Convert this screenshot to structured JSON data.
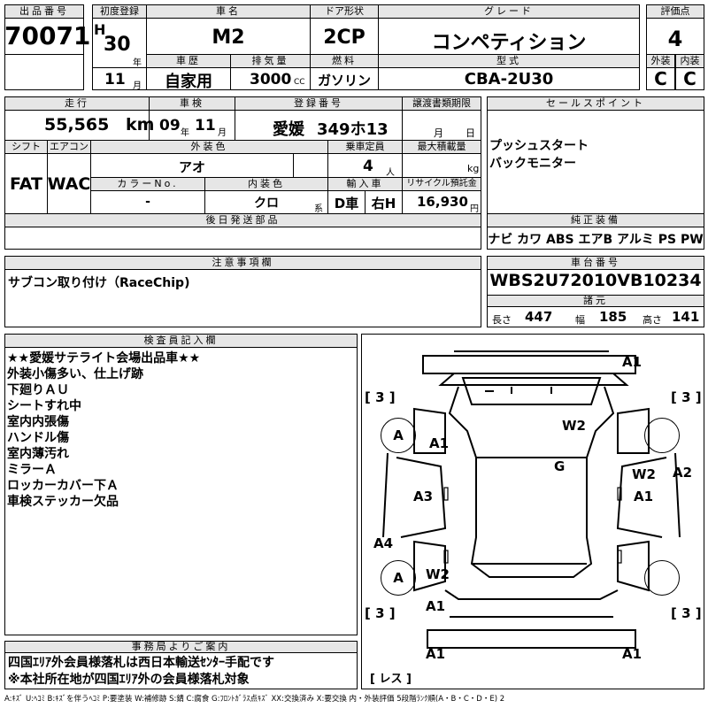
{
  "labels": {
    "lot_no": "出品番号",
    "first_reg": "初度登録",
    "car_name": "車名",
    "door": "ドア形状",
    "grade": "グレード",
    "score": "評価点",
    "history": "車歴",
    "displacement": "排気量",
    "fuel": "燃料",
    "model_code": "型式",
    "exterior": "外装",
    "interior": "内装",
    "mileage": "走行",
    "inspection": "車検",
    "reg_no": "登録番号",
    "transfer_docs": "譲渡書類期限",
    "sales_points": "セールスポイント",
    "shift": "シフト",
    "ac": "エアコン",
    "ext_color": "外装色",
    "capacity": "乗車定員",
    "max_load": "最大積載量",
    "color_no": "カラーNo.",
    "int_color": "内装色",
    "import": "輸入車",
    "recycle": "リサイクル預託金",
    "later_parts": "後日発送部品",
    "genuine_equip": "純正装備",
    "caution": "注意事項欄",
    "chassis_no": "車台番号",
    "specs": "諸元",
    "inspector": "検査員記入欄",
    "office": "事務局よりご案内",
    "year_unit": "年",
    "month_unit": "月",
    "month_unit2": "月",
    "day_unit": "日",
    "km_unit": "km",
    "cc_unit": "CC",
    "kg_unit": "kg",
    "person_unit": "人",
    "yen_unit": "円",
    "kei_unit": "系",
    "year_unit2": "年",
    "month_unit3": "月",
    "length": "長さ",
    "width": "幅",
    "height": "高さ"
  },
  "vehicle": {
    "lot_number": "70071",
    "era": "H",
    "year": "30",
    "month": "11",
    "name": "M2",
    "door": "2CP",
    "grade": "コンペティション",
    "score": "4",
    "history": "自家用",
    "displacement": "3000",
    "fuel": "ガソリン",
    "model_code": "CBA-2U30",
    "exterior_grade": "C",
    "interior_grade": "C",
    "mileage": "55,565",
    "inspection_year": "09",
    "inspection_month": "11",
    "reg_area": "愛媛",
    "reg_number": "349ホ13",
    "shift": "FAT",
    "ac": "WAC",
    "ext_color": "アオ",
    "capacity": "4",
    "color_no": "-",
    "int_color": "クロ",
    "import_type": "D車",
    "steering": "右H",
    "recycle_fee": "16,930",
    "chassis_no": "WBS2U72010VB10234",
    "length": "447",
    "width": "185",
    "height": "141"
  },
  "sales_points": [
    "プッシュスタート",
    "バックモニター"
  ],
  "equipment": "ナビ カワ ABS エアB アルミ PS PW",
  "caution_text": "サブコン取り付け（RaceChip)",
  "inspector_notes": [
    "★★愛媛サテライト会場出品車★★",
    "外装小傷多い、仕上げ跡",
    "下廻りＡＵ",
    "シートすれ中",
    "室内内張傷",
    "ハンドル傷",
    "室内薄汚れ",
    "ミラーＡ",
    "ロッカーカバー下Ａ",
    "車検ステッカー欠品"
  ],
  "office_notes": [
    "四国ｴﾘｱ外会員様落札は西日本輸送ｾﾝﾀｰ手配です",
    "※本社所在地が四国ｴﾘｱ外の会員様落札対象"
  ],
  "diagram": {
    "marks": {
      "a1_top": "A1",
      "b3_left_top": "[ 3 ]",
      "b3_right_top": "[ 3 ]",
      "w2_roof": "W2",
      "a_fl": "A",
      "a1_fl": "A1",
      "g": "G",
      "w2_r": "W2",
      "a2": "A2",
      "a3": "A3",
      "a1_r": "A1",
      "a4": "A4",
      "a_rl": "A",
      "w2_rl": "W2",
      "b3_left_bot": "[ 3 ]",
      "b3_right_bot": "[ 3 ]",
      "a1_rl": "A1",
      "a1_bl": "A1",
      "a1_br": "A1",
      "res": "[ レス ]"
    }
  },
  "legend": "A:ｷｽﾞ U:ﾍｺﾐ B:ｷｽﾞを伴うﾍｺﾐ P:要塗装 W:補修跡 S:錆 C:腐食 G:ﾌﾛﾝﾄｶﾞﾗｽ点ｷｽﾞ XX:交換済み X:要交換 内・外装評価 5段階ﾗﾝｸ順(A・B・C・D・E) 2"
}
